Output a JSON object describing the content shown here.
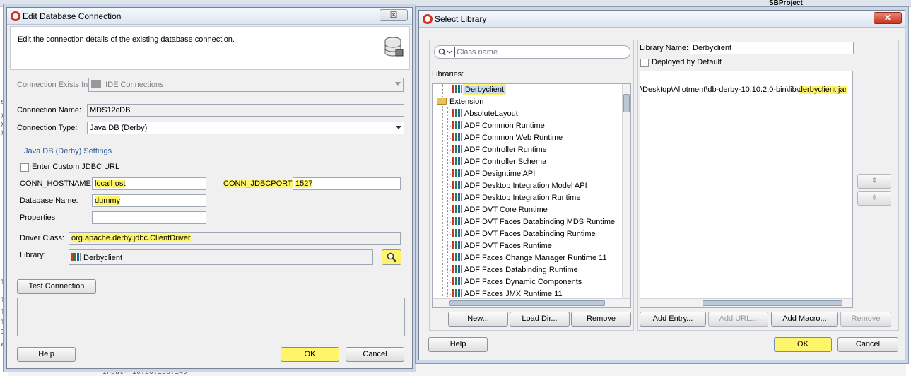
{
  "background": {
    "top_right_label": "SBProject",
    "bottom_text": "Input= 10.20.168.149",
    "edge_letters": [
      "s",
      "X",
      "X",
      "X",
      "T",
      "T",
      "T",
      "T",
      "1",
      "w"
    ]
  },
  "edit_dialog": {
    "title": "Edit Database Connection",
    "close_label": "☒",
    "header_text": "Edit the connection details of the existing database connection.",
    "connection_exists_in_label": "Connection Exists In:",
    "connection_exists_in_value": "IDE Connections",
    "connection_name_label": "Connection Name:",
    "connection_name_value": "MDS12cDB",
    "connection_type_label": "Connection Type:",
    "connection_type_value": "Java DB (Derby)",
    "section_title": "Java DB (Derby) Settings",
    "custom_jdbc_label": "Enter Custom JDBC URL",
    "hostname_label": "CONN_HOSTNAME",
    "hostname_value": "localhost",
    "jdbcport_label": "CONN_JDBCPORT",
    "jdbcport_value": "1527",
    "database_name_label": "Database Name:",
    "database_name_value": "dummy",
    "properties_label": "Properties",
    "properties_value": "",
    "driver_class_label": "Driver Class:",
    "driver_class_value": "org.apache.derby.jdbc.ClientDriver",
    "library_label": "Library:",
    "library_value": "Derbyclient",
    "test_connection_label": "Test Connection",
    "help_label": "Help",
    "ok_label": "OK",
    "cancel_label": "Cancel"
  },
  "select_library": {
    "title": "Select Library",
    "close_label": "✕",
    "search_placeholder": "Class name",
    "libraries_label": "Libraries:",
    "selected_library": "Derbyclient",
    "extension_folder": "Extension",
    "libraries": [
      "AbsoluteLayout",
      "ADF Common Runtime",
      "ADF Common Web Runtime",
      "ADF Controller Runtime",
      "ADF Controller Schema",
      "ADF Designtime API",
      "ADF Desktop Integration Model API",
      "ADF Desktop Integration Runtime",
      "ADF DVT Core Runtime",
      "ADF DVT Faces Databinding MDS Runtime",
      "ADF DVT Faces Databinding Runtime",
      "ADF DVT Faces Runtime",
      "ADF Faces Change Manager Runtime 11",
      "ADF Faces Databinding Runtime",
      "ADF Faces Dynamic Components",
      "ADF Faces JMX Runtime 11"
    ],
    "new_label": "New...",
    "load_dir_label": "Load Dir...",
    "remove_label": "Remove",
    "library_name_label": "Library Name:",
    "library_name_value": "Derbyclient",
    "deployed_by_default_label": "Deployed by Default",
    "classpath_prefix": "\\Desktop\\Allotment\\db-derby-10.10.2.0-bin\\lib\\",
    "classpath_jar": "derbyclient.jar",
    "add_entry_label": "Add Entry...",
    "add_url_label": "Add URL...",
    "add_macro_label": "Add Macro...",
    "remove_entry_label": "Remove",
    "move_up_label": "⇞",
    "move_down_label": "⇟",
    "help_label": "Help",
    "ok_label": "OK",
    "cancel_label": "Cancel"
  }
}
